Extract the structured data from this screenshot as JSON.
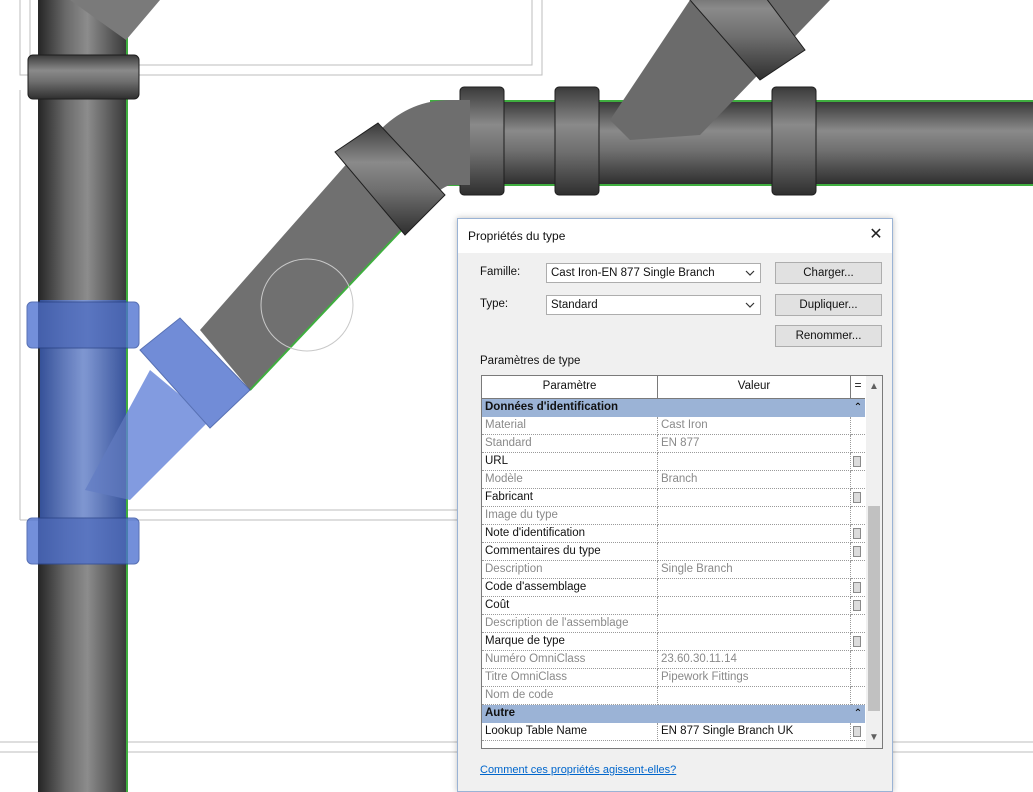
{
  "dialog": {
    "title": "Propriétés du type",
    "close_glyph": "✕",
    "famille_label": "Famille:",
    "famille_value": "Cast Iron-EN 877 Single Branch",
    "type_label": "Type:",
    "type_value": "Standard",
    "buttons": {
      "charger": "Charger...",
      "dupliquer": "Dupliquer...",
      "renommer": "Renommer..."
    },
    "section_label": "Paramètres de type",
    "columns": {
      "param": "Paramètre",
      "value": "Valeur",
      "sort": "="
    },
    "groups": {
      "identification": "Données d'identification",
      "autre": "Autre",
      "collapse_glyph": "⌃"
    },
    "rows": [
      {
        "p": "Material",
        "v": "Cast Iron",
        "dim": true,
        "btn": false
      },
      {
        "p": "Standard",
        "v": "EN 877",
        "dim": true,
        "btn": false
      },
      {
        "p": "URL",
        "v": "",
        "dim": false,
        "btn": true
      },
      {
        "p": "Modèle",
        "v": "Branch",
        "dim": true,
        "btn": false
      },
      {
        "p": "Fabricant",
        "v": "",
        "dim": false,
        "btn": true
      },
      {
        "p": "Image du type",
        "v": "",
        "dim": true,
        "btn": false
      },
      {
        "p": "Note d'identification",
        "v": "",
        "dim": false,
        "btn": true
      },
      {
        "p": "Commentaires du type",
        "v": "",
        "dim": false,
        "btn": true
      },
      {
        "p": "Description",
        "v": "Single Branch",
        "dim": true,
        "btn": false
      },
      {
        "p": "Code d'assemblage",
        "v": "",
        "dim": false,
        "btn": true
      },
      {
        "p": "Coût",
        "v": "",
        "dim": false,
        "btn": true
      },
      {
        "p": "Description de l'assemblage",
        "v": "",
        "dim": true,
        "btn": false
      },
      {
        "p": "Marque de type",
        "v": "",
        "dim": false,
        "btn": true
      },
      {
        "p": "Numéro OmniClass",
        "v": "23.60.30.11.14",
        "dim": true,
        "btn": false
      },
      {
        "p": "Titre OmniClass",
        "v": "Pipework Fittings",
        "dim": true,
        "btn": false
      },
      {
        "p": "Nom de code",
        "v": "",
        "dim": true,
        "btn": false
      }
    ],
    "other_rows": [
      {
        "p": "Lookup Table Name",
        "v": "EN 877 Single Branch UK",
        "dim": false,
        "btn": true
      }
    ],
    "help_link": "Comment ces propriétés agissent-elles?"
  },
  "colors": {
    "pipe": "#5a5a5a",
    "pipe_dark": "#2f2f2f",
    "pipe_light": "#8a8a8a",
    "selected": "#5a7fd6",
    "outline": "#3fae3f",
    "group_header": "#9bb3d6"
  }
}
